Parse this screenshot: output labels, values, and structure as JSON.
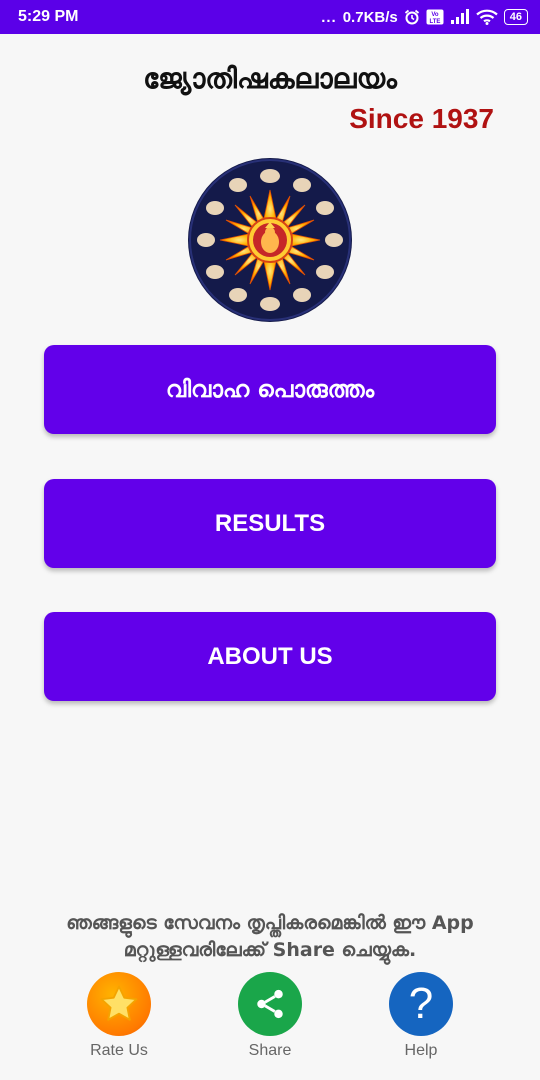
{
  "status_bar": {
    "time": "5:29 PM",
    "dots": "...",
    "network_speed": "0.7KB/s",
    "battery": "46",
    "volte": "Vo LTE"
  },
  "header": {
    "title": "ജ്യോതിഷകലാലയം",
    "since": "Since 1937"
  },
  "menu": {
    "match_label": "വിവാഹ പൊരുത്തം",
    "results_label": "RESULTS",
    "about_label": "ABOUT US"
  },
  "share_message": {
    "line1": "ഞങ്ങളുടെ സേവനം തൃപ്തികരമെങ്കിൽ ഈ App",
    "line2": "മറ്റുള്ളവരിലേക്ക് Share  ചെയ്യുക."
  },
  "bottom_bar": {
    "rate_label": "Rate Us",
    "share_label": "Share",
    "help_label": "Help",
    "help_glyph": "?"
  },
  "colors": {
    "status_bar": "#5b00e8",
    "button": "#6200ea",
    "since": "#b01212",
    "rate": "#ff8c00",
    "share": "#1aa64a",
    "help": "#1565c0"
  },
  "icons": [
    "alarm-icon",
    "volte-icon",
    "signal-icon",
    "wifi-icon",
    "battery-icon",
    "zodiac-wheel-logo",
    "star-icon",
    "share-icon",
    "help-icon"
  ]
}
